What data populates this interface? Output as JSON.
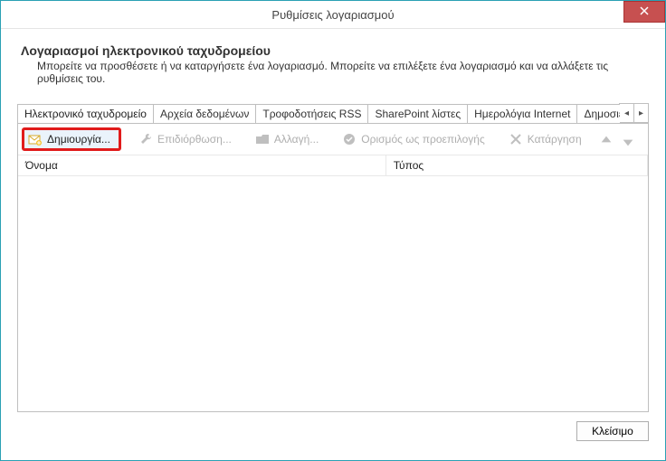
{
  "window": {
    "title": "Ρυθμίσεις λογαριασμού"
  },
  "header": {
    "heading": "Λογαριασμοί ηλεκτρονικού ταχυδρομείου",
    "description": "Μπορείτε να προσθέσετε ή να καταργήσετε ένα λογαριασμό. Μπορείτε να επιλέξετε ένα λογαριασμό και να αλλάξετε τις ρυθμίσεις του."
  },
  "tabs": {
    "items": [
      "Ηλεκτρονικό ταχυδρομείο",
      "Αρχεία δεδομένων",
      "Τροφοδοτήσεις RSS",
      "SharePoint λίστες",
      "Ημερολόγια Internet",
      "Δημοσιευμένα ημερολόγ"
    ],
    "scroll_left": "◂",
    "scroll_right": "▸"
  },
  "toolbar": {
    "new_label": "Δημιουργία...",
    "repair_label": "Επιδιόρθωση...",
    "change_label": "Αλλαγή...",
    "default_label": "Ορισμός ως προεπιλογής",
    "remove_label": "Κατάργηση"
  },
  "columns": {
    "name": "Όνομα",
    "type": "Τύπος"
  },
  "footer": {
    "close": "Κλείσιμο"
  }
}
